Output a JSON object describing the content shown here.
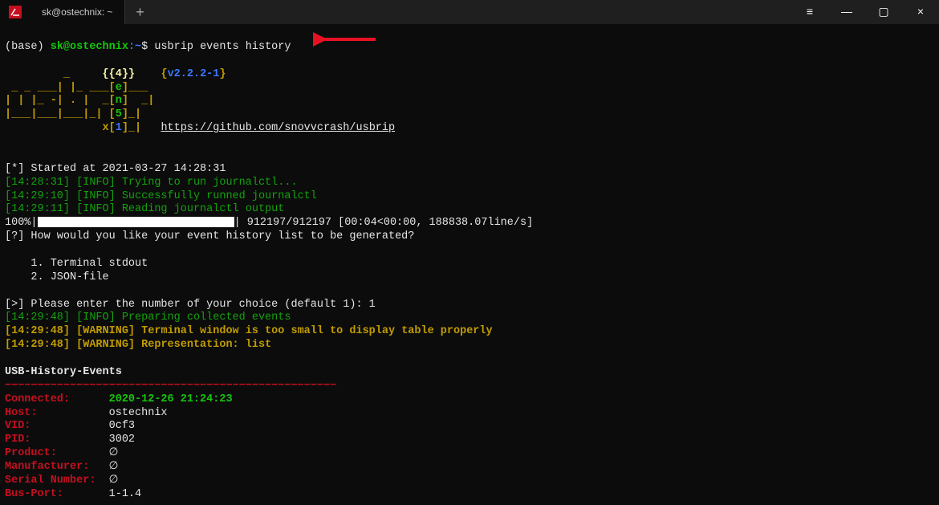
{
  "titlebar": {
    "tab_title": "sk@ostechnix: ~",
    "hamburger": "≡",
    "minimize": "—",
    "maximize": "▢",
    "close": "×",
    "plus": "+"
  },
  "prompt": {
    "prefix": "(base) ",
    "user_host": "sk@ostechnix",
    "path": ":~",
    "sigil": "$",
    "command": "usbrip events history"
  },
  "ascii": {
    "line1": "                     {{4}}    {v2.2.2-1}",
    "line2": "         _     {{4}}    {v2.2.2-1}",
    "l2a": "         _     ",
    "v4": "{{4}}",
    "vver_open": "{",
    "vver": "v2.2.2-1",
    "vver_close": "}",
    "l3": " _ _ ___| |_ ___[e]___ ",
    "l4": "| | |_ -| . |  _[n]  _|",
    "l5": "|___|___|___|_| [5]_|  ",
    "l6": "               x[1]_|   ",
    "url": "https://github.com/snovvcrash/usbrip"
  },
  "log": {
    "start": "[*] Started at 2021-03-27 14:28:31",
    "l1_time": "[14:28:31]",
    "l1_tag": " [INFO] ",
    "l1_msg": "Trying to run journalctl...",
    "l2_time": "[14:29:10]",
    "l2_tag": " [INFO] ",
    "l2_msg": "Successfully runned journalctl",
    "l3_time": "[14:29:11]",
    "l3_tag": " [INFO] ",
    "l3_msg": "Reading journalctl output",
    "progress_left": "100%|",
    "progress_right": "| 912197/912197 [00:04<00:00, 188838.07line/s]",
    "question": "[?] How would you like your event history list to be generated?",
    "opt1": "    1. Terminal stdout",
    "opt2": "    2. JSON-file",
    "choice": "[>] Please enter the number of your choice (default 1): 1",
    "l4_time": "[14:29:48]",
    "l4_tag": " [INFO] ",
    "l4_msg": "Preparing collected events",
    "l5_time": "[14:29:48]",
    "l5_tag": " [WARNING] ",
    "l5_msg": "Terminal window is too small to display table properly",
    "l6_time": "[14:29:48]",
    "l6_tag": " [WARNING] ",
    "l6_msg": "Representation: list"
  },
  "events": {
    "heading": "USB-History-Events",
    "rule": "−−−−−−−−−−−−−−−−−−−−−−−−−−−−−−−−−−−−−−−−−−−−−−−−−−−",
    "fields": [
      {
        "k": "Connected:",
        "v": "2020-12-26 21:24:23",
        "vclass": "green"
      },
      {
        "k": "Host:",
        "v": "ostechnix",
        "vclass": "white"
      },
      {
        "k": "VID:",
        "v": "0cf3",
        "vclass": "white"
      },
      {
        "k": "PID:",
        "v": "3002",
        "vclass": "white"
      },
      {
        "k": "Product:",
        "v": "∅",
        "vclass": "white"
      },
      {
        "k": "Manufacturer:",
        "v": "∅",
        "vclass": "white"
      },
      {
        "k": "Serial Number:",
        "v": "∅",
        "vclass": "white"
      },
      {
        "k": "Bus-Port:",
        "v": "1-1.4",
        "vclass": "white"
      }
    ]
  }
}
